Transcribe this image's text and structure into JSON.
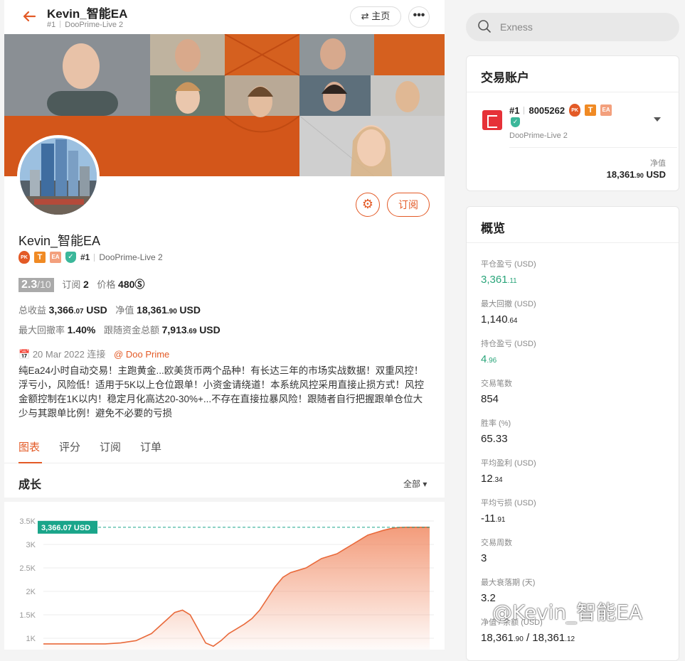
{
  "header": {
    "title": "Kevin_智能EA",
    "rank": "#1",
    "server": "DooPrime-Live 2",
    "home_label": "⇄ 主页",
    "more_label": "•••"
  },
  "profile": {
    "name": "Kevin_智能EA",
    "rank": "#1",
    "server": "DooPrime-Live 2",
    "badge_pk": "PK",
    "badge_t": "T",
    "badge_ea": "EA",
    "subscribe_label": "订阅",
    "score": "2.3",
    "score_max": "/10",
    "subs_label": "订阅",
    "subs_value": "2",
    "price_label": "价格",
    "price_value": "480",
    "price_icon": "Ⓢ",
    "total_profit_label": "总收益",
    "total_profit_main": "3,366",
    "total_profit_dec": ".07",
    "total_profit_unit": "USD",
    "equity_label": "净值",
    "equity_main": "18,361",
    "equity_dec": ".90",
    "equity_unit": "USD",
    "max_dd_label": "最大回撤率",
    "max_dd_value": "1.40%",
    "follow_label": "跟随资金总额",
    "follow_main": "7,913",
    "follow_dec": ".69",
    "follow_unit": "USD",
    "since_date": "20 Mar 2022 连接",
    "broker": "@ Doo Prime",
    "description": "纯Ea24小时自动交易！主跑黄金...欧美货币两个品种！有长达三年的市场实战数据！双重风控！浮亏小，风险低！适用于5K以上仓位跟单！小资金请绕道！本系统风控采用直接止损方式！风控金额控制在1K以内！稳定月化高达20-30%+...不存在直接拉暴风险！跟随者自行把握跟单仓位大少与其跟单比例！避免不必要的亏损"
  },
  "tabs": [
    {
      "label": "图表",
      "active": true
    },
    {
      "label": "评分",
      "active": false
    },
    {
      "label": "订阅",
      "active": false
    },
    {
      "label": "订单",
      "active": false
    }
  ],
  "growth": {
    "title": "成长",
    "range_label": "全部 ▾"
  },
  "chart_data": {
    "type": "area",
    "title": "",
    "xlabel": "",
    "ylabel": "",
    "y_ticks": [
      "3.5K",
      "3K",
      "2.5K",
      "2K",
      "1.5K",
      "1K"
    ],
    "ylim": [
      850,
      3500
    ],
    "current_label": "3,366.07 USD",
    "current_value": 3366.07,
    "color": "#ef7b4f",
    "series": [
      {
        "x": [
          0,
          4,
          8,
          12,
          16,
          20,
          24,
          28,
          30,
          32,
          34,
          36,
          38,
          40,
          42,
          44,
          46,
          48,
          50,
          52,
          54,
          56,
          58,
          60,
          62,
          64,
          66,
          68,
          70,
          72,
          74,
          76,
          78,
          80,
          82,
          84,
          86,
          88,
          90,
          92,
          94,
          96,
          98,
          100
        ],
        "values": [
          880,
          880,
          880,
          880,
          880,
          900,
          950,
          1100,
          1250,
          1400,
          1550,
          1600,
          1500,
          1200,
          900,
          830,
          950,
          1100,
          1200,
          1300,
          1420,
          1600,
          1850,
          2100,
          2300,
          2400,
          2450,
          2500,
          2600,
          2700,
          2750,
          2800,
          2900,
          3000,
          3100,
          3200,
          3250,
          3300,
          3340,
          3360,
          3366,
          3366,
          3366,
          3366
        ]
      }
    ]
  },
  "search": {
    "placeholder": "Exness"
  },
  "account_card": {
    "title": "交易账户",
    "rank": "#1",
    "number": "8005262",
    "badge_pk": "PK",
    "badge_t": "T",
    "badge_ea": "EA",
    "server": "DooPrime-Live 2",
    "equity_label": "净值",
    "equity_main": "18,361",
    "equity_dec": ".90",
    "equity_unit": "USD"
  },
  "overview": {
    "title": "概览",
    "items": [
      {
        "label": "平仓盈亏 (USD)",
        "main": "3,361",
        "dec": ".11",
        "green": true
      },
      {
        "label": "最大回撤 (USD)",
        "main": "1,140",
        "dec": ".64",
        "green": false
      },
      {
        "label": "持仓盈亏 (USD)",
        "main": "4",
        "dec": ".96",
        "green": true
      },
      {
        "label": "交易笔数",
        "main": "854",
        "dec": "",
        "green": false
      },
      {
        "label": "胜率 (%)",
        "main": "65.33",
        "dec": "",
        "green": false
      },
      {
        "label": "平均盈利 (USD)",
        "main": "12",
        "dec": ".34",
        "green": false
      },
      {
        "label": "平均亏损 (USD)",
        "main": "-11",
        "dec": ".91",
        "green": false
      },
      {
        "label": "交易周数",
        "main": "3",
        "dec": "",
        "green": false
      },
      {
        "label": "最大衰落期 (天)",
        "main": "3.2",
        "dec": "",
        "green": false
      },
      {
        "label": "净值 / 余额 (USD)",
        "main": "18,361",
        "dec": ".90",
        "extra": " / 18,361",
        "extra_dec": ".12",
        "green": false
      }
    ]
  },
  "watermark": "@Kevin_智能EA"
}
